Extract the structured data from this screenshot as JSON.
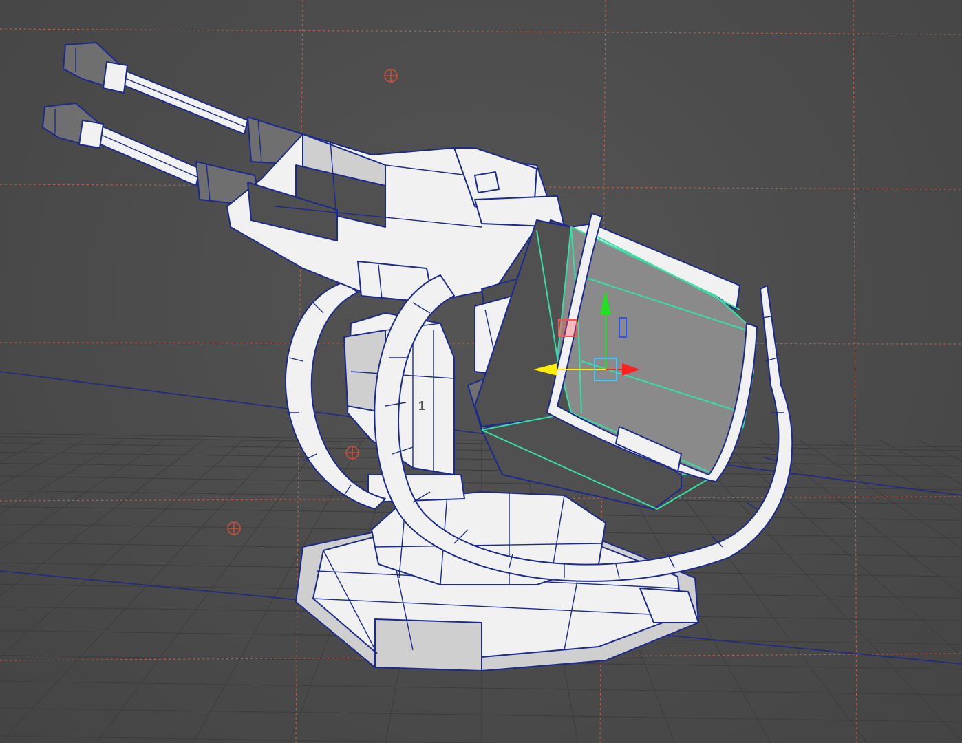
{
  "viewport": {
    "colors": {
      "background": "#4a4a4a",
      "grid": "#3c3c3c",
      "guide": "#b86048",
      "axis": "#1f2b80",
      "wireframe": "#1b2a8c",
      "selection": "#35e0a8",
      "manip_x": "#ff2020",
      "manip_y": "#20e020",
      "manip_z": "#3050ff",
      "manip_view": "#ffee00"
    },
    "mesh_label": "1",
    "icons": [
      "move-manipulator-icon",
      "pivot-locator-icon"
    ]
  }
}
